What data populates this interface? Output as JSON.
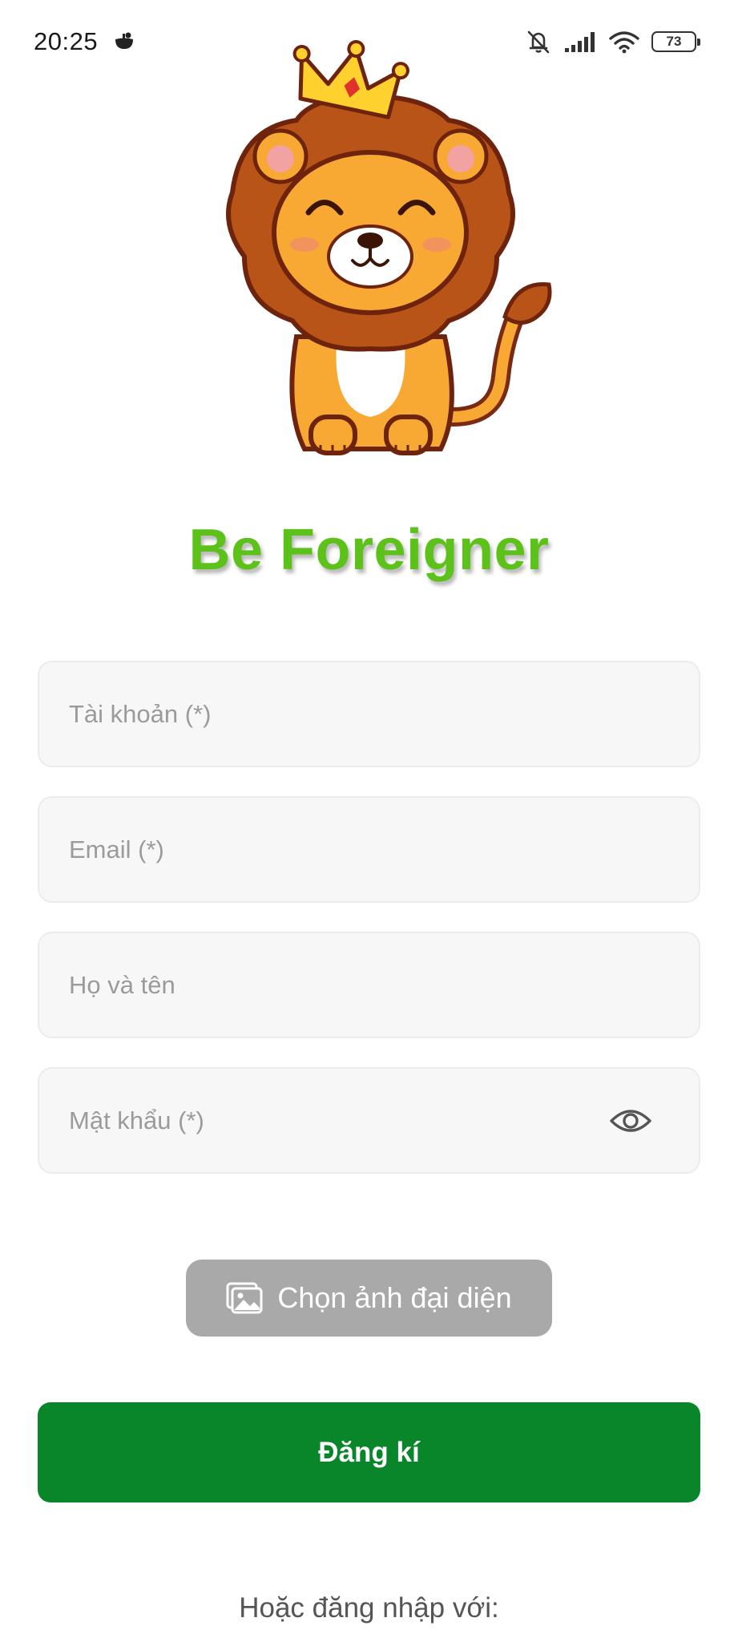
{
  "status_bar": {
    "time": "20:25",
    "app_icon": "notification-app-icon",
    "icons": [
      "bell-muted-icon",
      "signal-icon",
      "wifi-icon"
    ],
    "battery_level": "73"
  },
  "branding": {
    "mascot": "lion-with-crown-mascot",
    "title": "Be Foreigner",
    "title_color": "#5cc21a"
  },
  "form": {
    "account_placeholder": "Tài khoản (*)",
    "email_placeholder": "Email (*)",
    "name_placeholder": "Họ và tên",
    "password_placeholder": "Mật khẩu (*)",
    "password_toggle_icon": "eye-icon"
  },
  "avatar_button": {
    "label": "Chọn ảnh đại diện",
    "icon": "image-gallery-icon",
    "color": "#a9a9a9"
  },
  "register_button": {
    "label": "Đăng kí",
    "color": "#09852a"
  },
  "alt_login": {
    "label": "Hoặc đăng nhập với:"
  }
}
